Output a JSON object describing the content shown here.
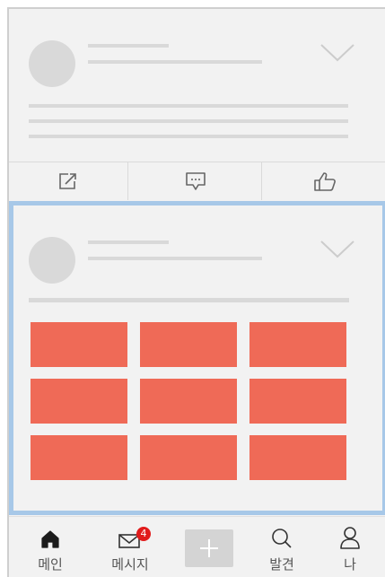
{
  "tabbar": {
    "home_label": "메인",
    "messages_label": "메시지",
    "messages_badge": "4",
    "discover_label": "발견",
    "me_label": "나"
  },
  "colors": {
    "background": "#f2f2f2",
    "placeholder": "#d9d9d9",
    "selection_border": "#a7c8e8",
    "image_tile": "#ef6a57",
    "badge": "#e11b1b"
  },
  "icons": {
    "card_actions": [
      "share-icon",
      "comment-icon",
      "like-icon"
    ],
    "tabs": [
      "home-icon",
      "mail-icon",
      "plus-icon",
      "search-icon",
      "user-icon"
    ]
  }
}
